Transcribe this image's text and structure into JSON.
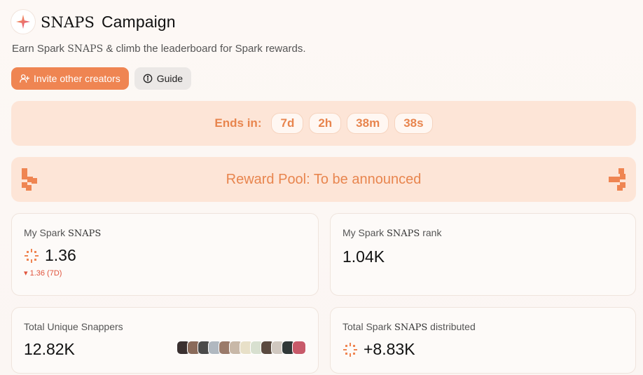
{
  "header": {
    "title_prefix": "SNAPS",
    "title_suffix": "Campaign",
    "subtitle_before": "Earn Spark ",
    "subtitle_snaps": "SNAPS",
    "subtitle_after": " & climb the leaderboard for Spark rewards."
  },
  "buttons": {
    "invite": "Invite other creators",
    "guide": "Guide"
  },
  "countdown": {
    "label": "Ends in:",
    "days": "7d",
    "hours": "2h",
    "minutes": "38m",
    "seconds": "38s"
  },
  "reward": {
    "text": "Reward Pool: To be announced"
  },
  "cards": {
    "my_snaps": {
      "label_before": "My Spark ",
      "label_snaps": "SNAPS",
      "value": "1.36",
      "delta": "▾ 1.36 (7D)"
    },
    "my_rank": {
      "label_before": "My Spark ",
      "label_snaps": "SNAPS",
      "label_after": " rank",
      "value": "1.04K"
    },
    "unique_snappers": {
      "label": "Total Unique Snappers",
      "value": "12.82K"
    },
    "distributed": {
      "label_before": "Total Spark ",
      "label_snaps": "SNAPS",
      "label_after": " distributed",
      "value": "+8.83K"
    }
  },
  "colors": {
    "accent": "#ef8552",
    "accent_text": "#e8854e",
    "panel": "#fde5d7",
    "negative": "#e0533c"
  },
  "avatar_colors": [
    "#3a3030",
    "#8a6a5a",
    "#4a4a4a",
    "#b0b8c0",
    "#9a7a6a",
    "#c8b8a8",
    "#e8e0c8",
    "#d8e0d0",
    "#5a4a40",
    "#d0c8c0",
    "#303838",
    "#c85a6a"
  ]
}
